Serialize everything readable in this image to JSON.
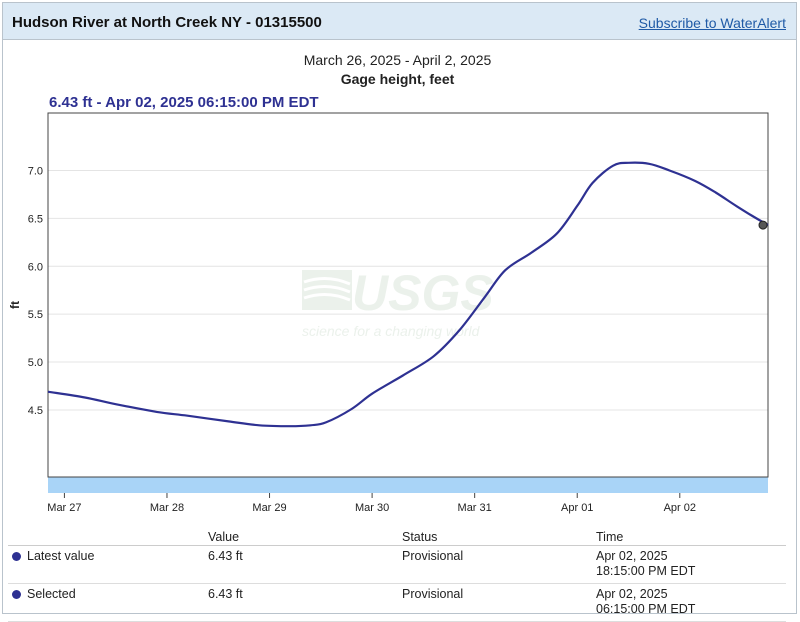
{
  "header": {
    "title": "Hudson River at North Creek NY - 01315500",
    "subscribe_label": "Subscribe to WaterAlert"
  },
  "chart_header": {
    "date_range": "March 26, 2025 - April 2, 2025",
    "parameter": "Gage height, feet",
    "readout": "6.43 ft - Apr 02, 2025 06:15:00 PM EDT"
  },
  "watermark": {
    "logo": "USGS",
    "tagline": "science for a changing world"
  },
  "chart_data": {
    "type": "line",
    "title": "Gage height, feet",
    "subtitle": "March 26, 2025 - April 2, 2025",
    "ylabel": "ft",
    "xlabel": "",
    "ylim": [
      3.8,
      7.6
    ],
    "xlim": [
      -0.16,
      6.86
    ],
    "y_ticks": [
      4.5,
      5.0,
      5.5,
      6.0,
      6.5,
      7.0
    ],
    "y_tick_labels": [
      "4.5",
      "5.0",
      "5.5",
      "6.0",
      "6.5",
      "7.0"
    ],
    "x_ticks": [
      0,
      1,
      2,
      3,
      4,
      5,
      6
    ],
    "x_tick_labels": [
      "Mar 27",
      "Mar 28",
      "Mar 29",
      "Mar 30",
      "Mar 31",
      "Apr 01",
      "Apr 02"
    ],
    "grid": "horizontal",
    "line_color": "#2e3192",
    "series": [
      {
        "x": [
          -0.16,
          0.2,
          0.5,
          0.9,
          1.2,
          1.6,
          1.9,
          2.2,
          2.4,
          2.55,
          2.8,
          3.0,
          3.3,
          3.6,
          3.85,
          4.1,
          4.3,
          4.55,
          4.8,
          5.0,
          5.15,
          5.35,
          5.5,
          5.7,
          5.9,
          6.15,
          6.35,
          6.55,
          6.7,
          6.86
        ],
        "y": [
          4.69,
          4.63,
          4.56,
          4.48,
          4.44,
          4.38,
          4.34,
          4.33,
          4.34,
          4.37,
          4.51,
          4.67,
          4.86,
          5.06,
          5.33,
          5.68,
          5.96,
          6.14,
          6.34,
          6.63,
          6.87,
          7.05,
          7.08,
          7.07,
          7.0,
          6.89,
          6.77,
          6.63,
          6.53,
          6.43
        ]
      }
    ],
    "selected_point": {
      "x": 6.86,
      "y": 6.43
    }
  },
  "table": {
    "headers": [
      "",
      "Value",
      "Status",
      "Time"
    ],
    "rows": [
      {
        "label": "Latest value",
        "value": "6.43 ft",
        "status": "Provisional",
        "time_date": "Apr 02, 2025",
        "time_clock": "18:15:00 PM EDT"
      },
      {
        "label": "Selected",
        "value": "6.43 ft",
        "status": "Provisional",
        "time_date": "Apr 02, 2025",
        "time_clock": "06:15:00 PM EDT"
      }
    ]
  }
}
